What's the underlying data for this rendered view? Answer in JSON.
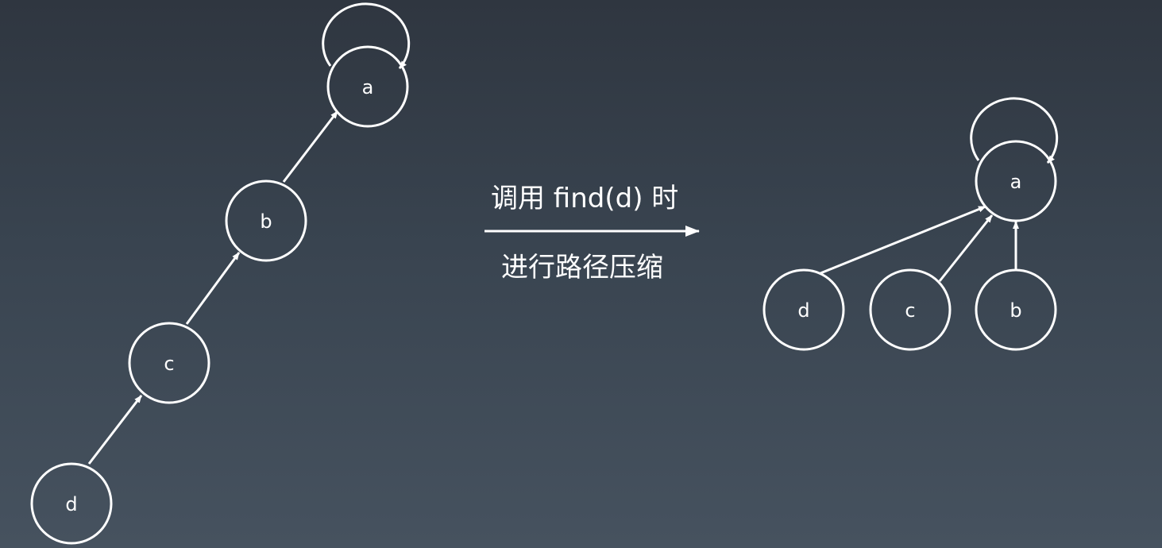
{
  "slide": {
    "before_tree": {
      "nodes": [
        {
          "id": "a",
          "label": "a",
          "self_loop": true
        },
        {
          "id": "b",
          "label": "b"
        },
        {
          "id": "c",
          "label": "c"
        },
        {
          "id": "d",
          "label": "d"
        }
      ],
      "edges": [
        {
          "from": "b",
          "to": "a"
        },
        {
          "from": "c",
          "to": "b"
        },
        {
          "from": "d",
          "to": "c"
        }
      ]
    },
    "transition": {
      "top_text": "调用 find(d) 时",
      "bottom_text": "进行路径压缩"
    },
    "after_tree": {
      "nodes": [
        {
          "id": "a",
          "label": "a",
          "self_loop": true
        },
        {
          "id": "d",
          "label": "d"
        },
        {
          "id": "c",
          "label": "c"
        },
        {
          "id": "b",
          "label": "b"
        }
      ],
      "edges": [
        {
          "from": "d",
          "to": "a"
        },
        {
          "from": "c",
          "to": "a"
        },
        {
          "from": "b",
          "to": "a"
        }
      ]
    },
    "colors": {
      "stroke": "#ffffff",
      "text": "#ffffff",
      "background_top": "#2f3640",
      "background_bottom": "#46525f"
    }
  }
}
